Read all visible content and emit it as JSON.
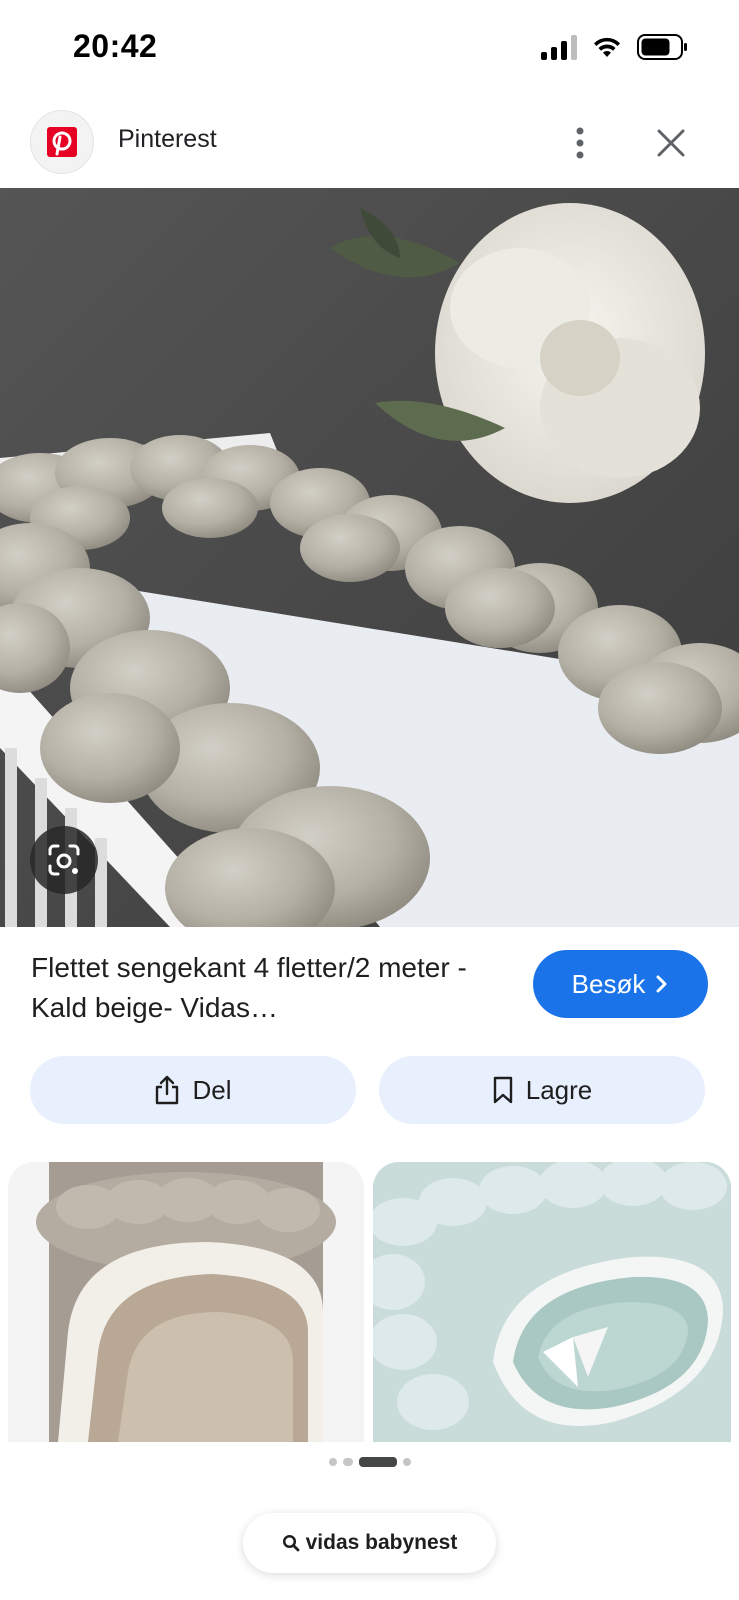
{
  "status_bar": {
    "time": "20:42",
    "icons": [
      "cellular-signal-icon",
      "wifi-icon",
      "battery-icon"
    ]
  },
  "header": {
    "app_title": "Pinterest",
    "logo_icon": "pinterest-logo",
    "menu_icon": "more-vert-icon",
    "close_icon": "close-icon"
  },
  "main_image": {
    "lens_icon": "google-lens-icon"
  },
  "result": {
    "title": "Flettet sengekant 4 fletter/2 meter -Kald beige- Vidas…",
    "visit_label": "Besøk"
  },
  "actions": {
    "share_label": "Del",
    "save_label": "Lagre"
  },
  "pager": {
    "count": 4,
    "active_index": 2
  },
  "search": {
    "query": "vidas babynest"
  },
  "colors": {
    "accent": "#1a73e8",
    "action_bg": "#e8f0fe",
    "pinterest_red": "#e60023"
  }
}
